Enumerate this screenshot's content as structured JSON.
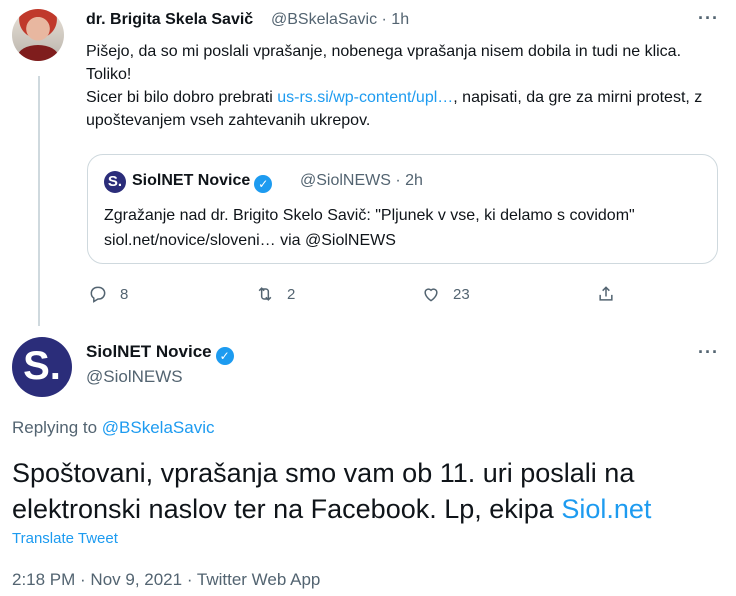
{
  "tweet1": {
    "name": "dr. Brigita Skela Savič",
    "handle": "@BSkelaSavic",
    "time": "· 1h",
    "more": "···",
    "text_a": "Pišejo, da so mi poslali vprašanje, nobenega vprašanja nisem dobila in tudi ne klica. Toliko!",
    "text_b_pre": "Sicer bi bilo dobro prebrati ",
    "text_b_link": "us-rs.si/wp-content/upl…",
    "text_b_post": ", napisati, da gre za mirni protest, z upoštevanjem vseh zahtevanih ukrepov.",
    "quote": {
      "avatar_letter": "S.",
      "name": "SiolNET Novice",
      "handle": "@SiolNEWS · 2h",
      "text": "Zgražanje nad dr. Brigito Skelo Savič: \"Pljunek v vse, ki delamo s covidom\" siol.net/novice/sloveni… via @SiolNEWS"
    },
    "actions": {
      "reply_count": "8",
      "retweet_count": "2",
      "like_count": "23"
    }
  },
  "tweet2": {
    "avatar_letter": "S.",
    "name": "SiolNET Novice",
    "handle": "@SiolNEWS",
    "more": "···",
    "replying_label": "Replying to ",
    "replying_handle": "@BSkelaSavic",
    "text_pre": "Spoštovani, vprašanja smo vam ob 11. uri poslali na elektronski naslov ter na Facebook. Lp, ekipa ",
    "text_link": "Siol.net",
    "translate": "Translate Tweet",
    "meta": "2:18 PM · Nov 9, 2021 · Twitter Web App"
  },
  "colors": {
    "accent": "#1d9bf0",
    "text": "#0f1419",
    "muted": "#536471",
    "siol_brand": "#2b2d7a"
  },
  "icons": [
    "reply-icon",
    "retweet-icon",
    "like-icon",
    "share-icon",
    "verified-icon",
    "more-icon"
  ]
}
